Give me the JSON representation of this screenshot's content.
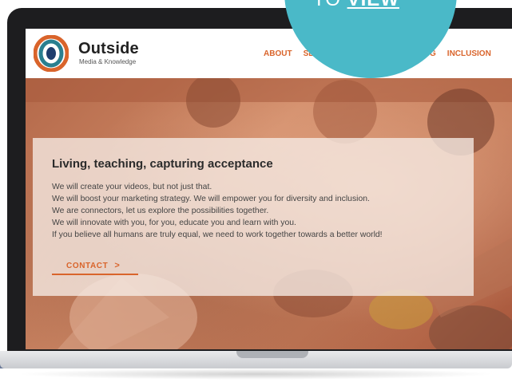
{
  "brand": {
    "name": "Outside",
    "tagline": "Media & Knowledge"
  },
  "nav": {
    "items": [
      "ABOUT",
      "SE",
      "BLOG",
      "INCLUSION"
    ]
  },
  "hero": {
    "title": "Living, teaching, capturing acceptance",
    "lines": [
      "We will create your videos, but not just that.",
      "We will boost your marketing strategy. We will empower you for diversity and inclusion.",
      "We are connectors, let us explore the possibilities together.",
      "We will innovate with you, for you, educate you and learn with you.",
      "If you believe all humans are truly equal, we need to work together towards a better world!"
    ],
    "cta_label": "CONTACT",
    "cta_chevron": ">"
  },
  "badge": {
    "prefix": "TO",
    "emphasis": "VIEW",
    "color": "#4ab9c8"
  },
  "colors": {
    "accent": "#d9642b",
    "hero_tint": "#c98462"
  },
  "icons": {
    "logo": "outside-logo-icon",
    "cta": "chevron-right-icon"
  }
}
